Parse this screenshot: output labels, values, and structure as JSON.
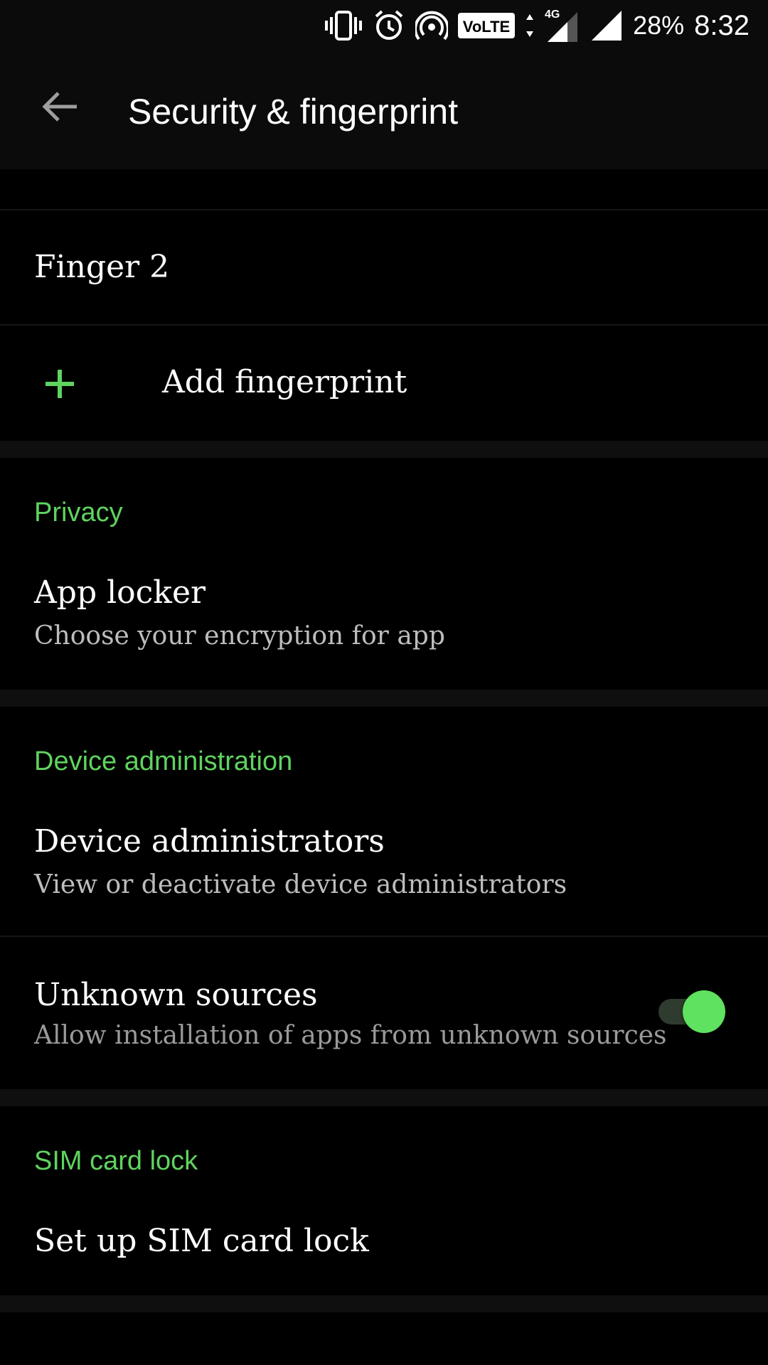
{
  "status_bar": {
    "battery": "28%",
    "time": "8:32",
    "volte_label": "VoLTE",
    "network_label": "4G",
    "icons": [
      "vibrate-icon",
      "alarm-icon",
      "hotspot-icon",
      "volte-icon",
      "data-arrows-icon",
      "signal-4g-icon",
      "signal-icon"
    ]
  },
  "toolbar": {
    "title": "Security & fingerprint",
    "back_icon": "back-arrow-icon"
  },
  "fingerprints": {
    "items": [
      {
        "label": "Finger 2"
      }
    ],
    "add_label": "Add fingerprint",
    "add_icon": "plus-icon"
  },
  "sections": [
    {
      "header": "Privacy",
      "items": [
        {
          "title": "App locker",
          "subtitle": "Choose your encryption for app"
        }
      ]
    },
    {
      "header": "Device administration",
      "items": [
        {
          "title": "Device administrators",
          "subtitle": "View or deactivate device administrators"
        },
        {
          "title": "Unknown sources",
          "subtitle": "Allow installation of apps from unknown sources",
          "toggle": true
        }
      ]
    },
    {
      "header": "SIM card lock",
      "items": [
        {
          "title": "Set up SIM card lock"
        }
      ]
    }
  ],
  "colors": {
    "accent": "#5fd35f",
    "background": "#000000",
    "toolbar": "#0b0b0b",
    "subtitle": "#bdbdbd"
  }
}
